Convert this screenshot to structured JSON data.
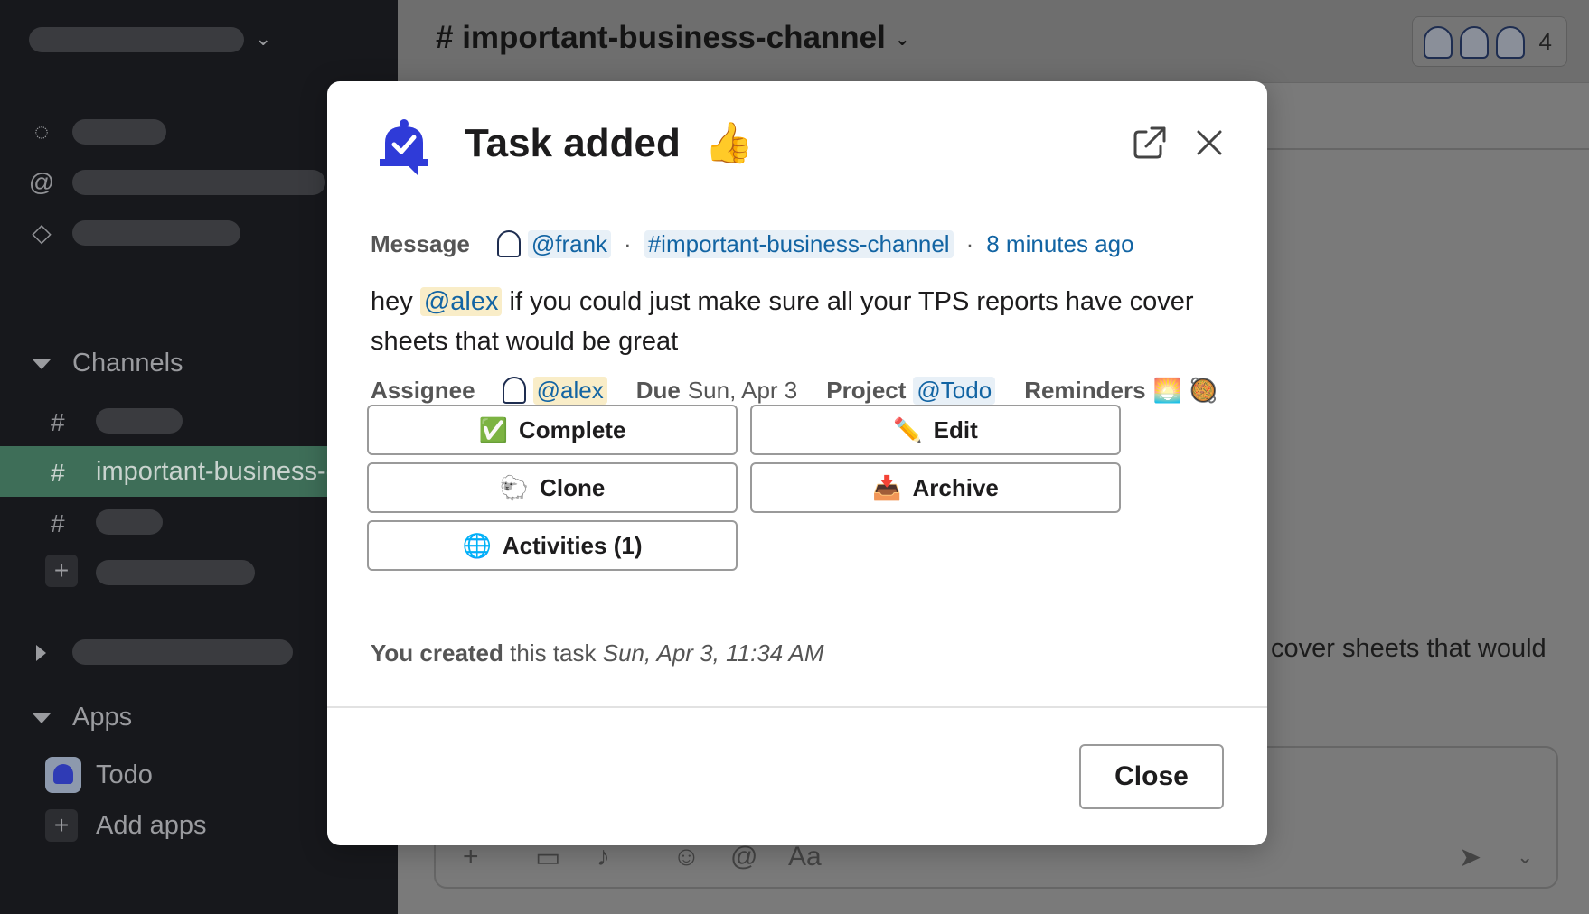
{
  "header": {
    "channel_title": "# important-business-channel",
    "member_count": "4"
  },
  "sidebar": {
    "channels_label": "Channels",
    "active_channel": "important-business-channel",
    "apps_label": "Apps",
    "apps": [
      {
        "label": "Todo"
      },
      {
        "label": "Add apps"
      }
    ]
  },
  "background_message": "cover sheets that would",
  "composer": {
    "format_label": "Aa"
  },
  "modal": {
    "title": "Task added",
    "title_emoji": "👍",
    "meta": {
      "label": "Message",
      "author": "@frank",
      "channel": "#important-business-channel",
      "time": "8 minutes ago"
    },
    "message": {
      "prefix": "hey",
      "mention": "@alex",
      "rest": "if you could just make sure all your TPS reports have cover sheets that would be great"
    },
    "fields": {
      "assignee_label": "Assignee",
      "assignee": "@alex",
      "due_label": "Due",
      "due": "Sun, Apr 3",
      "project_label": "Project",
      "project": "@Todo",
      "reminders_label": "Reminders",
      "reminders_emoji": "🌅 🥘"
    },
    "buttons": [
      {
        "emoji": "✅",
        "label": "Complete"
      },
      {
        "emoji": "✏️",
        "label": "Edit"
      },
      {
        "emoji": "🐑",
        "label": "Clone"
      },
      {
        "emoji": "📥",
        "label": "Archive"
      },
      {
        "emoji": "🌐",
        "label": "Activities (1)"
      }
    ],
    "footer": {
      "who": "You created",
      "text": "this task",
      "when": "Sun, Apr 3, 11:34 AM"
    },
    "close_label": "Close"
  }
}
